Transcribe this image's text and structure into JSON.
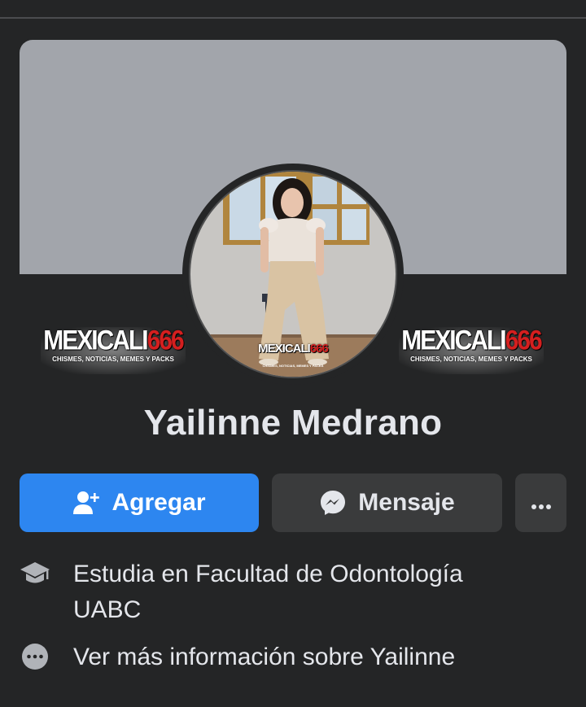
{
  "profile": {
    "name": "Yailinne Medrano"
  },
  "watermarks": {
    "brand_text": "MEXICALI",
    "brand_number": "666",
    "tagline": "CHISMES, NOTICIAS, MEMES Y PACKS"
  },
  "actions": {
    "add_label": "Agregar",
    "add_icon": "add-friend-icon",
    "message_label": "Mensaje",
    "message_icon": "messenger-icon",
    "more_label": "···",
    "more_icon": "more-options-icon",
    "add_color": "#2d86f0",
    "secondary_color": "#3a3b3c"
  },
  "info": {
    "education_text": "Estudia en Facultad de Odontología UABC",
    "education_icon": "graduation-cap-icon",
    "more_info_text": "Ver más información sobre Yailinne",
    "more_info_icon": "more-dots-icon"
  },
  "colors": {
    "background": "#242526",
    "cover": "#a2a5ab",
    "text": "#e4e6eb"
  }
}
